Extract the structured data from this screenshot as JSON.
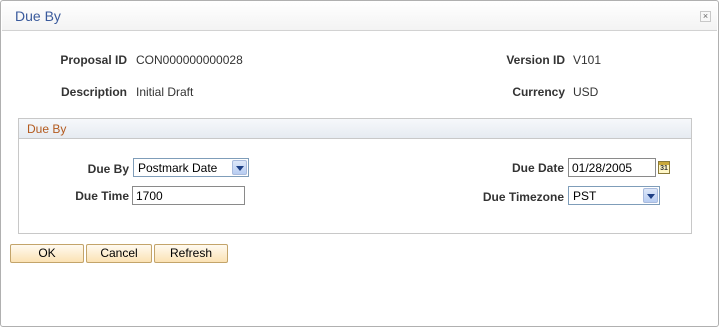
{
  "dialog": {
    "title": "Due By",
    "close_glyph": "×"
  },
  "header": {
    "proposal_id_label": "Proposal ID",
    "proposal_id_value": "CON000000000028",
    "version_id_label": "Version ID",
    "version_id_value": "V101",
    "description_label": "Description",
    "description_value": "Initial Draft",
    "currency_label": "Currency",
    "currency_value": "USD"
  },
  "group": {
    "title": "Due By",
    "due_by_label": "Due By",
    "due_by_value": "Postmark Date",
    "due_date_label": "Due Date",
    "due_date_value": "01/28/2005",
    "calendar_glyph": "31",
    "due_time_label": "Due Time",
    "due_time_value": "1700",
    "due_timezone_label": "Due Timezone",
    "due_timezone_value": "PST"
  },
  "buttons": {
    "ok": "OK",
    "cancel": "Cancel",
    "refresh": "Refresh"
  },
  "colors": {
    "title_text": "#3a5a9c",
    "group_title_text": "#b35a1e",
    "button_border": "#c3a46a"
  }
}
